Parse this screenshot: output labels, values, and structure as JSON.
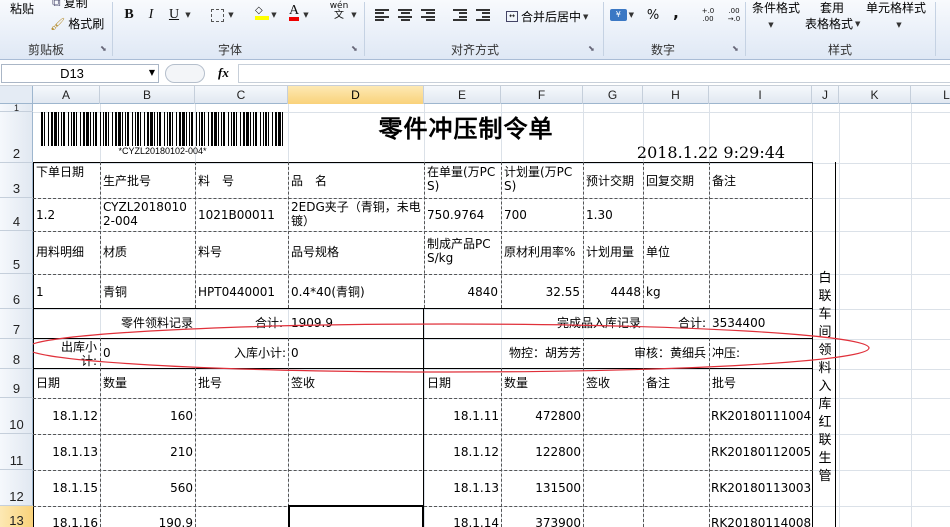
{
  "ribbon": {
    "clipboard": {
      "paste": "粘贴",
      "copy": "复制",
      "format_painter": "格式刷",
      "label": "剪贴板"
    },
    "font": {
      "bold": "B",
      "italic": "I",
      "underline": "U",
      "font_color": "A",
      "phonetic": "wén",
      "label": "字体"
    },
    "alignment": {
      "merge_center": "合并后居中",
      "label": "对齐方式"
    },
    "number": {
      "percent": "%",
      "comma": ",",
      "inc_decimal": "+.0 .00",
      "dec_decimal": ".00 →.0",
      "label": "数字"
    },
    "styles": {
      "conditional": "条件格式",
      "apply": "套用",
      "table_format": "表格格式",
      "cell_styles": "单元格样式",
      "label": "样式"
    }
  },
  "formula_bar": {
    "name_box": "D13",
    "fx": "fx",
    "value": ""
  },
  "columns": [
    "A",
    "B",
    "C",
    "D",
    "E",
    "F",
    "G",
    "H",
    "I",
    "J",
    "K",
    "L"
  ],
  "selected_column": "D",
  "rows": [
    "1",
    "2",
    "3",
    "4",
    "5",
    "6",
    "7",
    "8",
    "9",
    "10",
    "11",
    "12",
    "13"
  ],
  "selected_row": "13",
  "doc": {
    "title": "零件冲压制令单",
    "datetime": "2018.1.22 9:29:44",
    "barcode_text": "*CYZL20180102-004*",
    "side_text": "白联车间领料入库 红联生管",
    "r3": {
      "a": "下单日期",
      "b": "生产批号",
      "c": "料　号",
      "d": "品　名",
      "e": "在单量(万PCS)",
      "f": "计划量(万PCS)",
      "g": "预计交期",
      "h": "回复交期",
      "i": "备注"
    },
    "r4": {
      "a": "1.2",
      "b": "CYZL20180102-004",
      "c": "1021B00011",
      "d": "2EDG夹子（青铜，未电镀）",
      "e": "750.9764",
      "f": "700",
      "g": "1.30"
    },
    "r5": {
      "a": "用料明细",
      "b": "材质",
      "c": "料号",
      "d": "品号规格",
      "e": "制成产品PCS/kg",
      "f": "原材利用率%",
      "g": "计划用量",
      "h": "单位"
    },
    "r6": {
      "a": "1",
      "b": "青铜",
      "c": "HPT0440001",
      "d": "0.4*40(青铜)",
      "e": "4840",
      "f": "32.55",
      "g": "4448",
      "h": "kg"
    },
    "r7": {
      "left_label": "零件领料记录",
      "left_total_label": "合计:",
      "left_total": "1909.9",
      "right_label": "完成品入库记录",
      "right_total_label": "合计:",
      "right_total": "3534400"
    },
    "r8": {
      "out_label": "出库小计:",
      "out_value": "0",
      "in_label": "入库小计:",
      "in_value": "0",
      "control": "物控：胡芳芳",
      "audit": "审核：黄细兵",
      "stamp": "冲压:"
    },
    "r9": {
      "a": "日期",
      "b": "数量",
      "c": "批号",
      "d": "签收",
      "e": "日期",
      "f": "数量",
      "g": "签收",
      "h": "备注",
      "i": "批号"
    },
    "records": [
      {
        "date": "18.1.12",
        "qty": "160",
        "in_date": "18.1.11",
        "in_qty": "472800",
        "lot": "RK20180111004"
      },
      {
        "date": "18.1.13",
        "qty": "210",
        "in_date": "18.1.12",
        "in_qty": "122800",
        "lot": "RK20180112005"
      },
      {
        "date": "18.1.15",
        "qty": "560",
        "in_date": "18.1.13",
        "in_qty": "131500",
        "lot": "RK20180113003"
      },
      {
        "date": "18.1.16",
        "qty": "190.9",
        "in_date": "18.1.14",
        "in_qty": "373900",
        "lot": "RK20180114008"
      }
    ]
  }
}
